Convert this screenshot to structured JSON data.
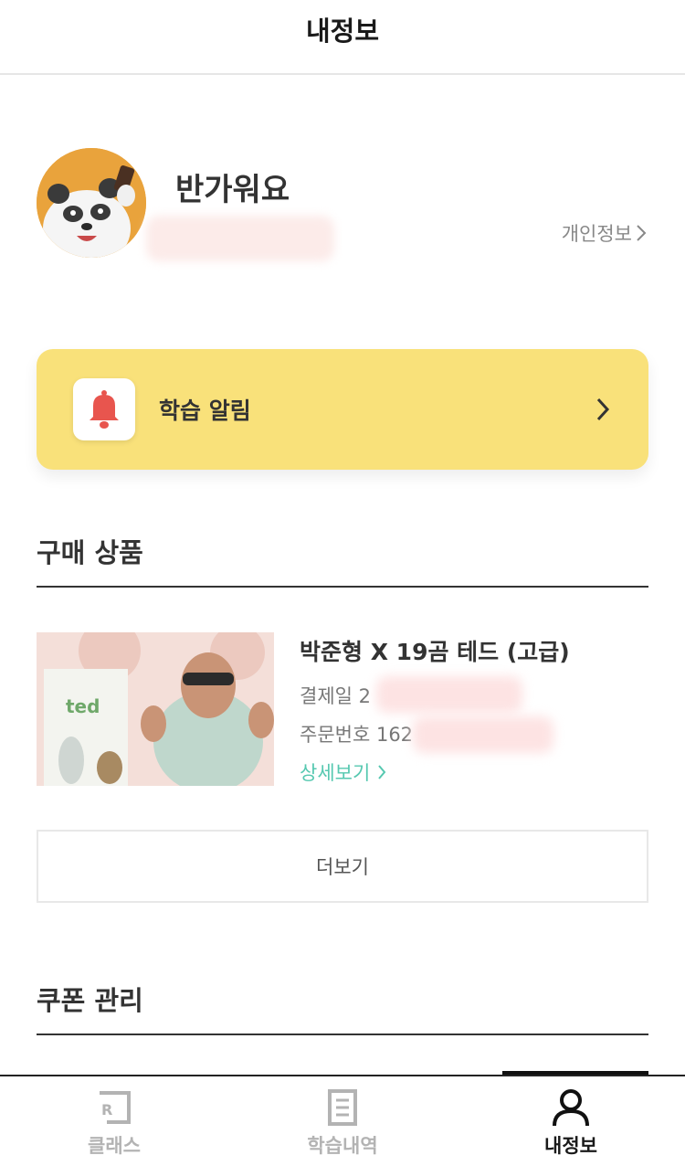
{
  "header": {
    "title": "내정보"
  },
  "profile": {
    "greeting": "반가워요",
    "link_label": "개인정보"
  },
  "alarm": {
    "label": "학습 알림"
  },
  "purchases": {
    "section_title": "구매 상품",
    "item": {
      "name": "박준형 X 19곰 테드 (고급)",
      "paid_date_label": "결제일 2",
      "order_number_label": "주문번호 162",
      "detail_label": "상세보기",
      "thumb_word": "ted"
    },
    "more_label": "더보기"
  },
  "coupons": {
    "section_title": "쿠폰 관리"
  },
  "nav": {
    "items": [
      {
        "label": "클래스",
        "icon": "class-r-icon",
        "active": false
      },
      {
        "label": "학습내역",
        "icon": "document-icon",
        "active": false
      },
      {
        "label": "내정보",
        "icon": "person-icon",
        "active": true
      }
    ]
  },
  "colors": {
    "alarm_bg": "#f9e17a",
    "bell": "#e8554e",
    "detail_link": "#56c8b0",
    "nav_inactive": "#b3b3b3"
  }
}
